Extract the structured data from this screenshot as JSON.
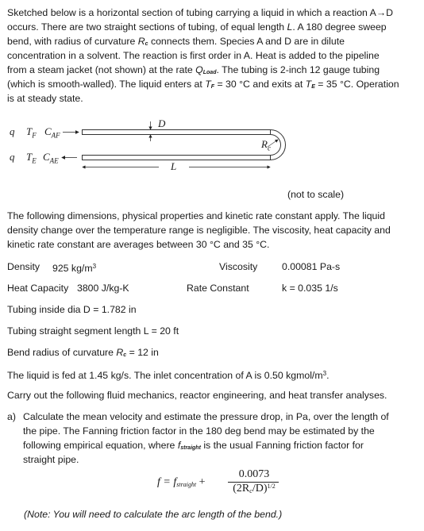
{
  "intro": {
    "lines": [
      "Sketched below is a horizontal section of tubing carrying a liquid in which a reaction A→D",
      "occurs.  There are two straight sections of tubing, of equal length ",
      "bend, with radius of curvature ",
      "concentration in a solvent. The reaction is first order in A.  Heat is added to the pipeline",
      "from a steam jacket (not shown) at the rate ",
      "(which is smooth-walled).   The liquid enters at ",
      "is at steady state."
    ],
    "line2_var": "L",
    "line2_tail": ".  A 180 degree sweep",
    "line3_var": "R",
    "line3_sub": "c",
    "line3_tail": " connects them.  Species A and D are in dilute",
    "line5_var": "Q",
    "line5_sub": "Load",
    "line5_tail": ".   The tubing is 2-inch 12 gauge tubing",
    "line6_tf_var": "T",
    "line6_tf_sub": "F",
    "line6_tf_val": " = 30 °C and exits at ",
    "line6_te_var": "T",
    "line6_te_sub": "E",
    "line6_te_val": " = 35 °C.  Operation"
  },
  "diagram": {
    "inlet_labels": {
      "q": "q",
      "T": "T",
      "T_sub": "F",
      "C": "C",
      "C_sub": "AF"
    },
    "outlet_labels": {
      "q": "q",
      "T": "T",
      "T_sub": "E",
      "C": "C",
      "C_sub": "AE"
    },
    "diameter_label": "D",
    "length_label": "L",
    "radius_label": "R",
    "radius_sub": "c",
    "caption": "(not to scale)"
  },
  "properties_intro": [
    "The following dimensions, physical properties and kinetic rate constant apply.  The liquid",
    "density change over the temperature range is negligible.  The viscosity, heat capacity and",
    "kinetic rate constant are averages between 30 °C and 35 °C."
  ],
  "properties": {
    "density_label": "Density",
    "density_value": "925 kg/m",
    "density_exp": "3",
    "viscosity_label": "Viscosity",
    "viscosity_value": "0.00081 Pa-s",
    "heat_capacity_label": "Heat Capacity",
    "heat_capacity_value": "3800 J/kg-K",
    "rate_constant_label": "Rate Constant",
    "rate_constant_value": "k = 0.035 1/s",
    "diameter_line": "Tubing inside dia D =  1.782 in",
    "length_line": "Tubing straight segment length L = 20 ft",
    "bend_label": "Bend radius of curvature   ",
    "bend_var": "R",
    "bend_sub": "c",
    "bend_value": " = 12 in"
  },
  "feed": {
    "text": "The liquid is fed at 1.45 kg/s.  The inlet concentration of A is 0.50 kgmol/m",
    "exp": "3",
    "tail": "."
  },
  "instructions": "Carry out the following fluid mechanics, reactor engineering, and heat transfer analyses.",
  "part_a": {
    "marker": "a)",
    "lines": [
      "Calculate the mean velocity and estimate the pressure drop, in Pa, over the length of",
      "the pipe.  The Fanning friction factor in the 180 deg bend may be estimated by the",
      "following empirical equation, where ",
      "straight pipe."
    ],
    "line3_var": "f",
    "line3_sub": "straight",
    "line3_tail": " is the usual Fanning friction factor for",
    "equation": {
      "lhs": "f = f",
      "lhs_sub": "straight",
      "plus": "+",
      "numerator": "0.0073",
      "denominator": "(2R",
      "denominator_sub": "c",
      "denominator_tail": "/D)",
      "denominator_exp": "1/2"
    },
    "note": "(Note:  You will need to calculate the arc length of the bend.)"
  }
}
